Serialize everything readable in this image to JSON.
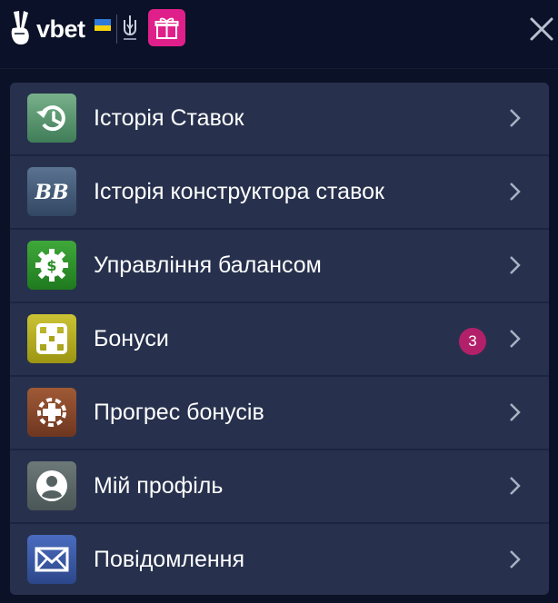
{
  "header": {
    "brand": "vbet",
    "close_icon": "close-icon",
    "gift_icon": "gift-icon",
    "colors": {
      "background": "#0a1128",
      "gift": "#e0208a"
    }
  },
  "menu": {
    "items": [
      {
        "label": "Історія Ставок",
        "icon": "history-icon",
        "color": "#5a9a72"
      },
      {
        "label": "Історія конструктора ставок",
        "icon": "bet-builder-icon",
        "color": "#47607f"
      },
      {
        "label": "Управління балансом",
        "icon": "balance-gear-icon",
        "color": "#2e8f2a"
      },
      {
        "label": "Бонуси",
        "icon": "bonus-icon",
        "color": "#b4ad20",
        "badge": "3"
      },
      {
        "label": "Прогрес бонусів",
        "icon": "bonus-progress-icon",
        "color": "#8a4a2c"
      },
      {
        "label": "Мій профіль",
        "icon": "profile-icon",
        "color": "#5e6a6a"
      },
      {
        "label": "Повідомлення",
        "icon": "messages-icon",
        "color": "#3a5aa6"
      }
    ]
  }
}
